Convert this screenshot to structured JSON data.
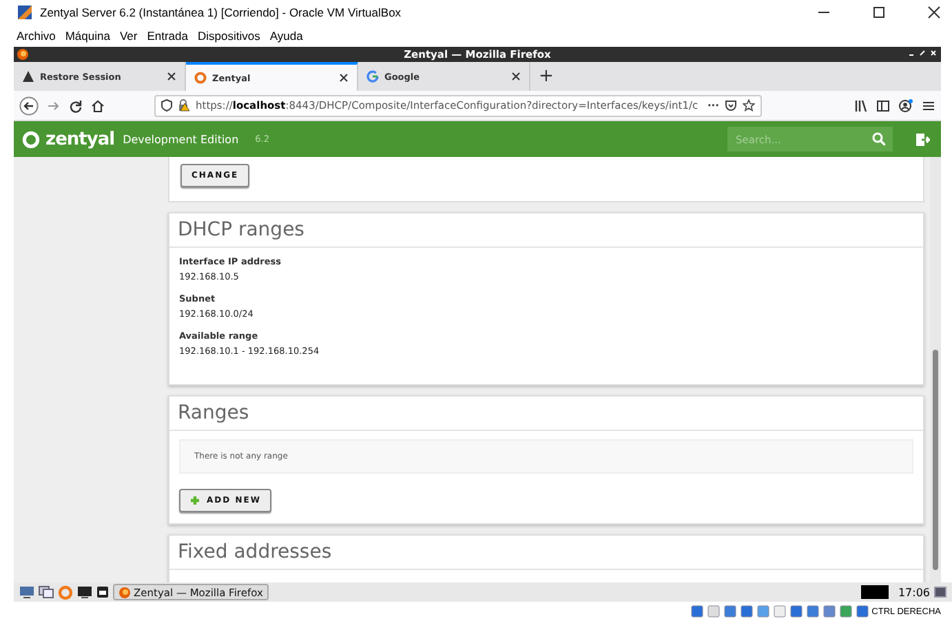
{
  "vbox_window": {
    "title": "Zentyal Server 6.2  (Instantánea 1) [Corriendo] - Oracle VM VirtualBox",
    "menu": [
      "Archivo",
      "Máquina",
      "Ver",
      "Entrada",
      "Dispositivos",
      "Ayuda"
    ]
  },
  "firefox": {
    "title": "Zentyal — Mozilla Firefox",
    "tabs": [
      {
        "label": "Restore Session",
        "selected": false,
        "kind": "warning"
      },
      {
        "label": "Zentyal",
        "selected": true,
        "kind": "zentyal"
      },
      {
        "label": "Google",
        "selected": false,
        "kind": "google"
      }
    ],
    "new_tab": "+",
    "url": "https://**localhost**:8443/DHCP/Composite/InterfaceConfiguration?directory=Interfaces/keys/int1/c",
    "more": "···"
  },
  "app": {
    "logo": "zentyal",
    "edition": "Development Edition",
    "version": "6.2",
    "search": {
      "placeholder": "Search..."
    }
  },
  "change_button": "CHANGE",
  "dhcp_ranges": {
    "title": "DHCP ranges",
    "fields": [
      {
        "label": "Interface IP address",
        "value": "192.168.10.5"
      },
      {
        "label": "Subnet",
        "value": "192.168.10.0/24"
      },
      {
        "label": "Available range",
        "value": "192.168.10.1 - 192.168.10.254"
      }
    ]
  },
  "ranges": {
    "title": "Ranges",
    "empty_message": "There is not any range",
    "add_button": "ADD NEW"
  },
  "fixed_addresses": {
    "title": "Fixed addresses"
  },
  "taskbar": {
    "task": "Zentyal — Mozilla Firefox",
    "clock": "17:06"
  },
  "status_bar": {
    "host_key": "CTRL DERECHA"
  }
}
